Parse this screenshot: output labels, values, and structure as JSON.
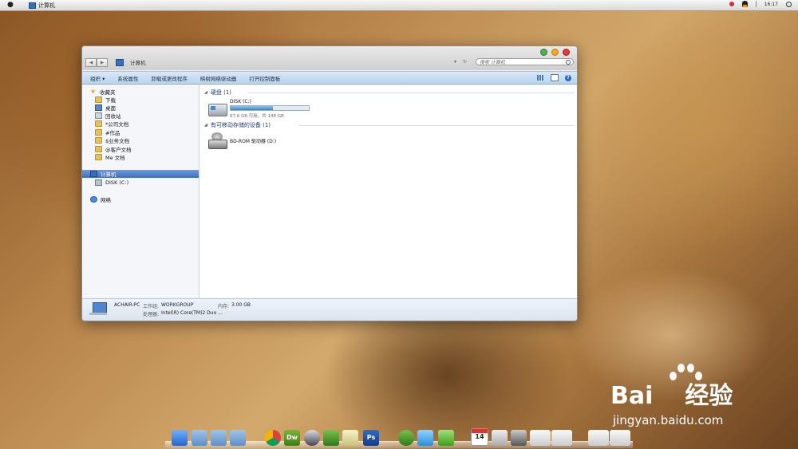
{
  "menubar": {
    "app_title": "计算机",
    "clock": "16:17"
  },
  "window": {
    "title": "计算机",
    "search_placeholder": "搜索 计算机",
    "toolbar": [
      "组织",
      "系统属性",
      "卸载或更改程序",
      "映射网络驱动器",
      "打开控制面板"
    ],
    "organize_arrow": "▾",
    "help_label": "?",
    "sidebar": {
      "favorites_label": "收藏夹",
      "favorites": [
        "下载",
        "桌面",
        "回收站",
        "*公司文档",
        "#作品",
        "$业务文档",
        "@客户文档",
        "Me 文档"
      ],
      "computer_label": "计算机",
      "computer_children": [
        "DISK (C:)"
      ],
      "network_label": "网络"
    },
    "groups": [
      {
        "title": "硬盘",
        "count": "(1)",
        "drives": [
          {
            "name": "DISK (C:)",
            "info": "67.6 GB 可用，共 148 GB",
            "used_fraction": 0.54
          }
        ]
      },
      {
        "title": "有可移动存储的设备",
        "count": "(1)",
        "drives": [
          {
            "name": "BD-ROM 驱动器 (D:)"
          }
        ]
      }
    ],
    "status": {
      "pc_name": "ACHAIR-PC",
      "workgroup_label": "工作组:",
      "workgroup": "WORKGROUP",
      "memory_label": "内存:",
      "memory": "3.00 GB",
      "processor_label": "处理器:",
      "processor": "Intel(R) Core(TM)2 Duo ..."
    }
  },
  "dock": {
    "calendar_day": "14",
    "dw_label": "Dw",
    "ps_label": "Ps"
  },
  "watermark": {
    "brand": "Bai",
    "brand_cn": "经验",
    "url": "jingyan.baidu.com"
  }
}
